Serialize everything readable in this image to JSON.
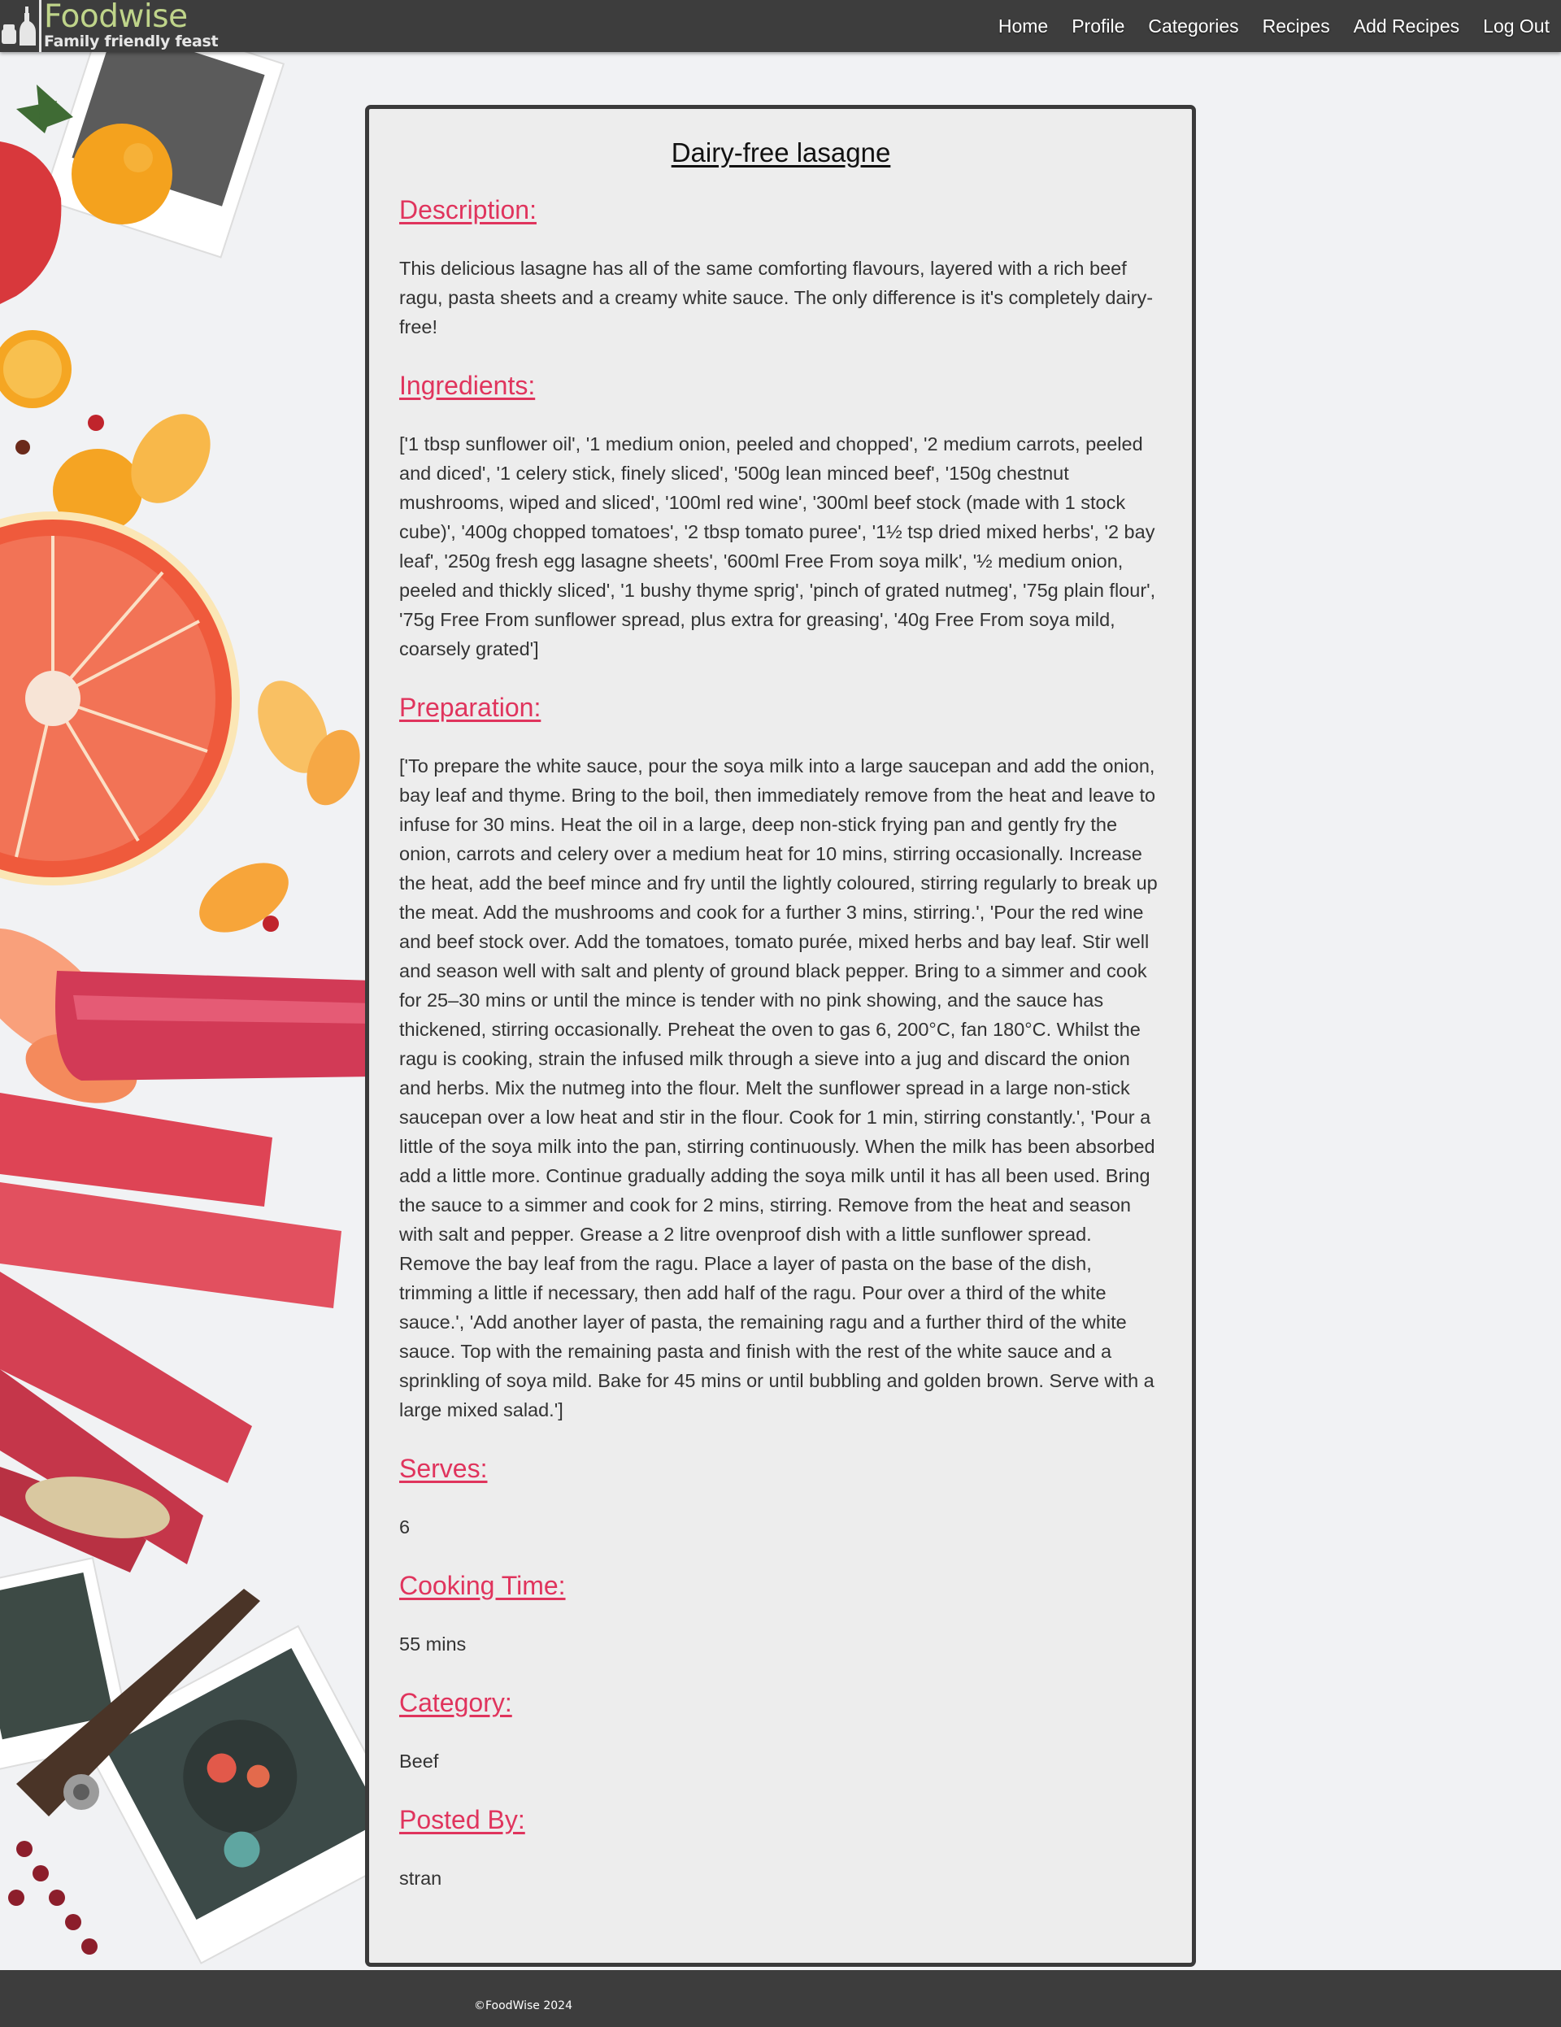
{
  "brand": {
    "name": "Foodwise",
    "tagline": "Family friendly feast",
    "color": "#bfd48a"
  },
  "nav": {
    "items": [
      {
        "label": "Home"
      },
      {
        "label": "Profile"
      },
      {
        "label": "Categories"
      },
      {
        "label": "Recipes"
      },
      {
        "label": "Add Recipes"
      },
      {
        "label": "Log Out"
      }
    ]
  },
  "recipe": {
    "title": "Dairy-free lasagne",
    "sections": [
      {
        "heading": "Description:",
        "body": "This delicious lasagne has all of the same comforting flavours, layered with a rich beef ragu, pasta sheets and a creamy white sauce. The only difference is it's completely dairy-free!"
      },
      {
        "heading": "Ingredients:",
        "body": "['1 tbsp sunflower oil', '1 medium onion, peeled and chopped', '2 medium carrots, peeled and diced', '1 celery stick, finely sliced', '500g lean minced beef', '150g chestnut mushrooms, wiped and sliced', '100ml red wine', '300ml beef stock (made with 1 stock cube)', '400g chopped tomatoes', '2 tbsp tomato puree', '1½ tsp dried mixed herbs', '2 bay leaf', '250g fresh egg lasagne sheets', '600ml Free From soya milk', '½ medium onion, peeled and thickly sliced', '1 bushy thyme sprig', 'pinch of grated nutmeg', '75g plain flour', '75g Free From sunflower spread, plus extra for greasing', '40g Free From soya mild, coarsely grated']"
      },
      {
        "heading": "Preparation:",
        "body": "['To prepare the white sauce, pour the soya milk into a large saucepan and add the onion, bay leaf and thyme. Bring to the boil, then immediately remove from the heat and leave to infuse for 30 mins. Heat the oil in a large, deep non-stick frying pan and gently fry the onion, carrots and celery over a medium heat for 10 mins, stirring occasionally. Increase the heat, add the beef mince and fry until the lightly coloured, stirring regularly to break up the meat. Add the mushrooms and cook for a further 3 mins, stirring.', 'Pour the red wine and beef stock over. Add the tomatoes, tomato purée, mixed herbs and bay leaf. Stir well and season well with salt and plenty of ground black pepper. Bring to a simmer and cook for 25–30 mins or until the mince is tender with no pink showing, and the sauce has thickened, stirring occasionally. Preheat the oven to gas 6, 200°C, fan 180°C. Whilst the ragu is cooking, strain the infused milk through a sieve into a jug and discard the onion and herbs. Mix the nutmeg into the flour. Melt the sunflower spread in a large non-stick saucepan over a low heat and stir in the flour. Cook for 1 min, stirring constantly.', 'Pour a little of the soya milk into the pan, stirring continuously. When the milk has been absorbed add a little more. Continue gradually adding the soya milk until it has all been used. Bring the sauce to a simmer and cook for 2 mins, stirring. Remove from the heat and season with salt and pepper. Grease a 2 litre ovenproof dish with a little sunflower spread. Remove the bay leaf from the ragu. Place a layer of pasta on the base of the dish, trimming a little if necessary, then add half of the ragu. Pour over a third of the white sauce.', 'Add another layer of pasta, the remaining ragu and a further third of the white sauce. Top with the remaining pasta and finish with the rest of the white sauce and a sprinkling of soya mild. Bake for 45 mins or until bubbling and golden brown. Serve with a large mixed salad.']"
      },
      {
        "heading": "Serves:",
        "body": "6"
      },
      {
        "heading": "Cooking Time:",
        "body": "55 mins"
      },
      {
        "heading": "Category:",
        "body": "Beef"
      },
      {
        "heading": "Posted By:",
        "body": "stran"
      }
    ]
  },
  "footer": {
    "text": "©FoodWise 2024"
  },
  "colors": {
    "navbar": "#3d3d3d",
    "heading_accent": "#e0345d",
    "card_background": "#ededed",
    "page_background": "#f1f2f4"
  }
}
